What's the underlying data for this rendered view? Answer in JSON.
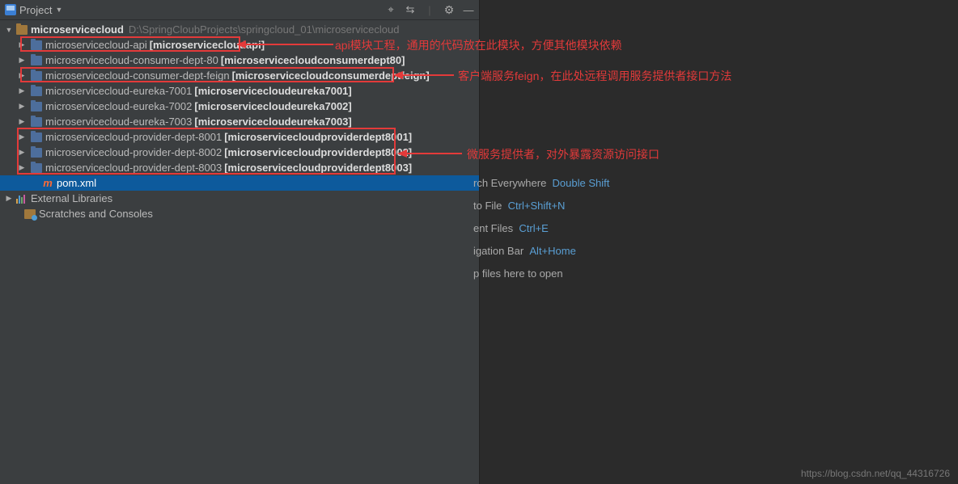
{
  "header": {
    "title": "Project"
  },
  "root": {
    "name": "microservicecloud",
    "path": "D:\\SpringCloubProjects\\springcloud_01\\microservicecloud"
  },
  "modules": [
    {
      "name": "microservicecloud-api",
      "bracket": "[microservicecloudapi]"
    },
    {
      "name": "microservicecloud-consumer-dept-80",
      "bracket": "[microservicecloudconsumerdept80]"
    },
    {
      "name": "microservicecloud-consumer-dept-feign",
      "bracket": "[microservicecloudconsumerdeptfeign]"
    },
    {
      "name": "microservicecloud-eureka-7001",
      "bracket": "[microservicecloudeureka7001]"
    },
    {
      "name": "microservicecloud-eureka-7002",
      "bracket": "[microservicecloudeureka7002]"
    },
    {
      "name": "microservicecloud-eureka-7003",
      "bracket": "[microservicecloudeureka7003]"
    },
    {
      "name": "microservicecloud-provider-dept-8001",
      "bracket": "[microservicecloudproviderdept8001]"
    },
    {
      "name": "microservicecloud-provider-dept-8002",
      "bracket": "[microservicecloudproviderdept8002]"
    },
    {
      "name": "microservicecloud-provider-dept-8003",
      "bracket": "[microservicecloudproviderdept8003]"
    }
  ],
  "files": {
    "pom": "pom.xml"
  },
  "external": {
    "libs": "External Libraries",
    "scratch": "Scratches and Consoles"
  },
  "tips": [
    {
      "pre": "rch Everywhere",
      "shortcut": "Double Shift"
    },
    {
      "pre": "to File",
      "shortcut": "Ctrl+Shift+N"
    },
    {
      "pre": "ent Files",
      "shortcut": "Ctrl+E"
    },
    {
      "pre": "igation Bar",
      "shortcut": "Alt+Home"
    },
    {
      "pre": "p files here to open",
      "shortcut": ""
    }
  ],
  "annotations": {
    "a1": "api模块工程，通用的代码放在此模块，方便其他模块依赖",
    "a2": "客户端服务feign，在此处远程调用服务提供者接口方法",
    "a3": "微服务提供者，对外暴露资源访问接口"
  },
  "watermark": "https://blog.csdn.net/qq_44316726"
}
